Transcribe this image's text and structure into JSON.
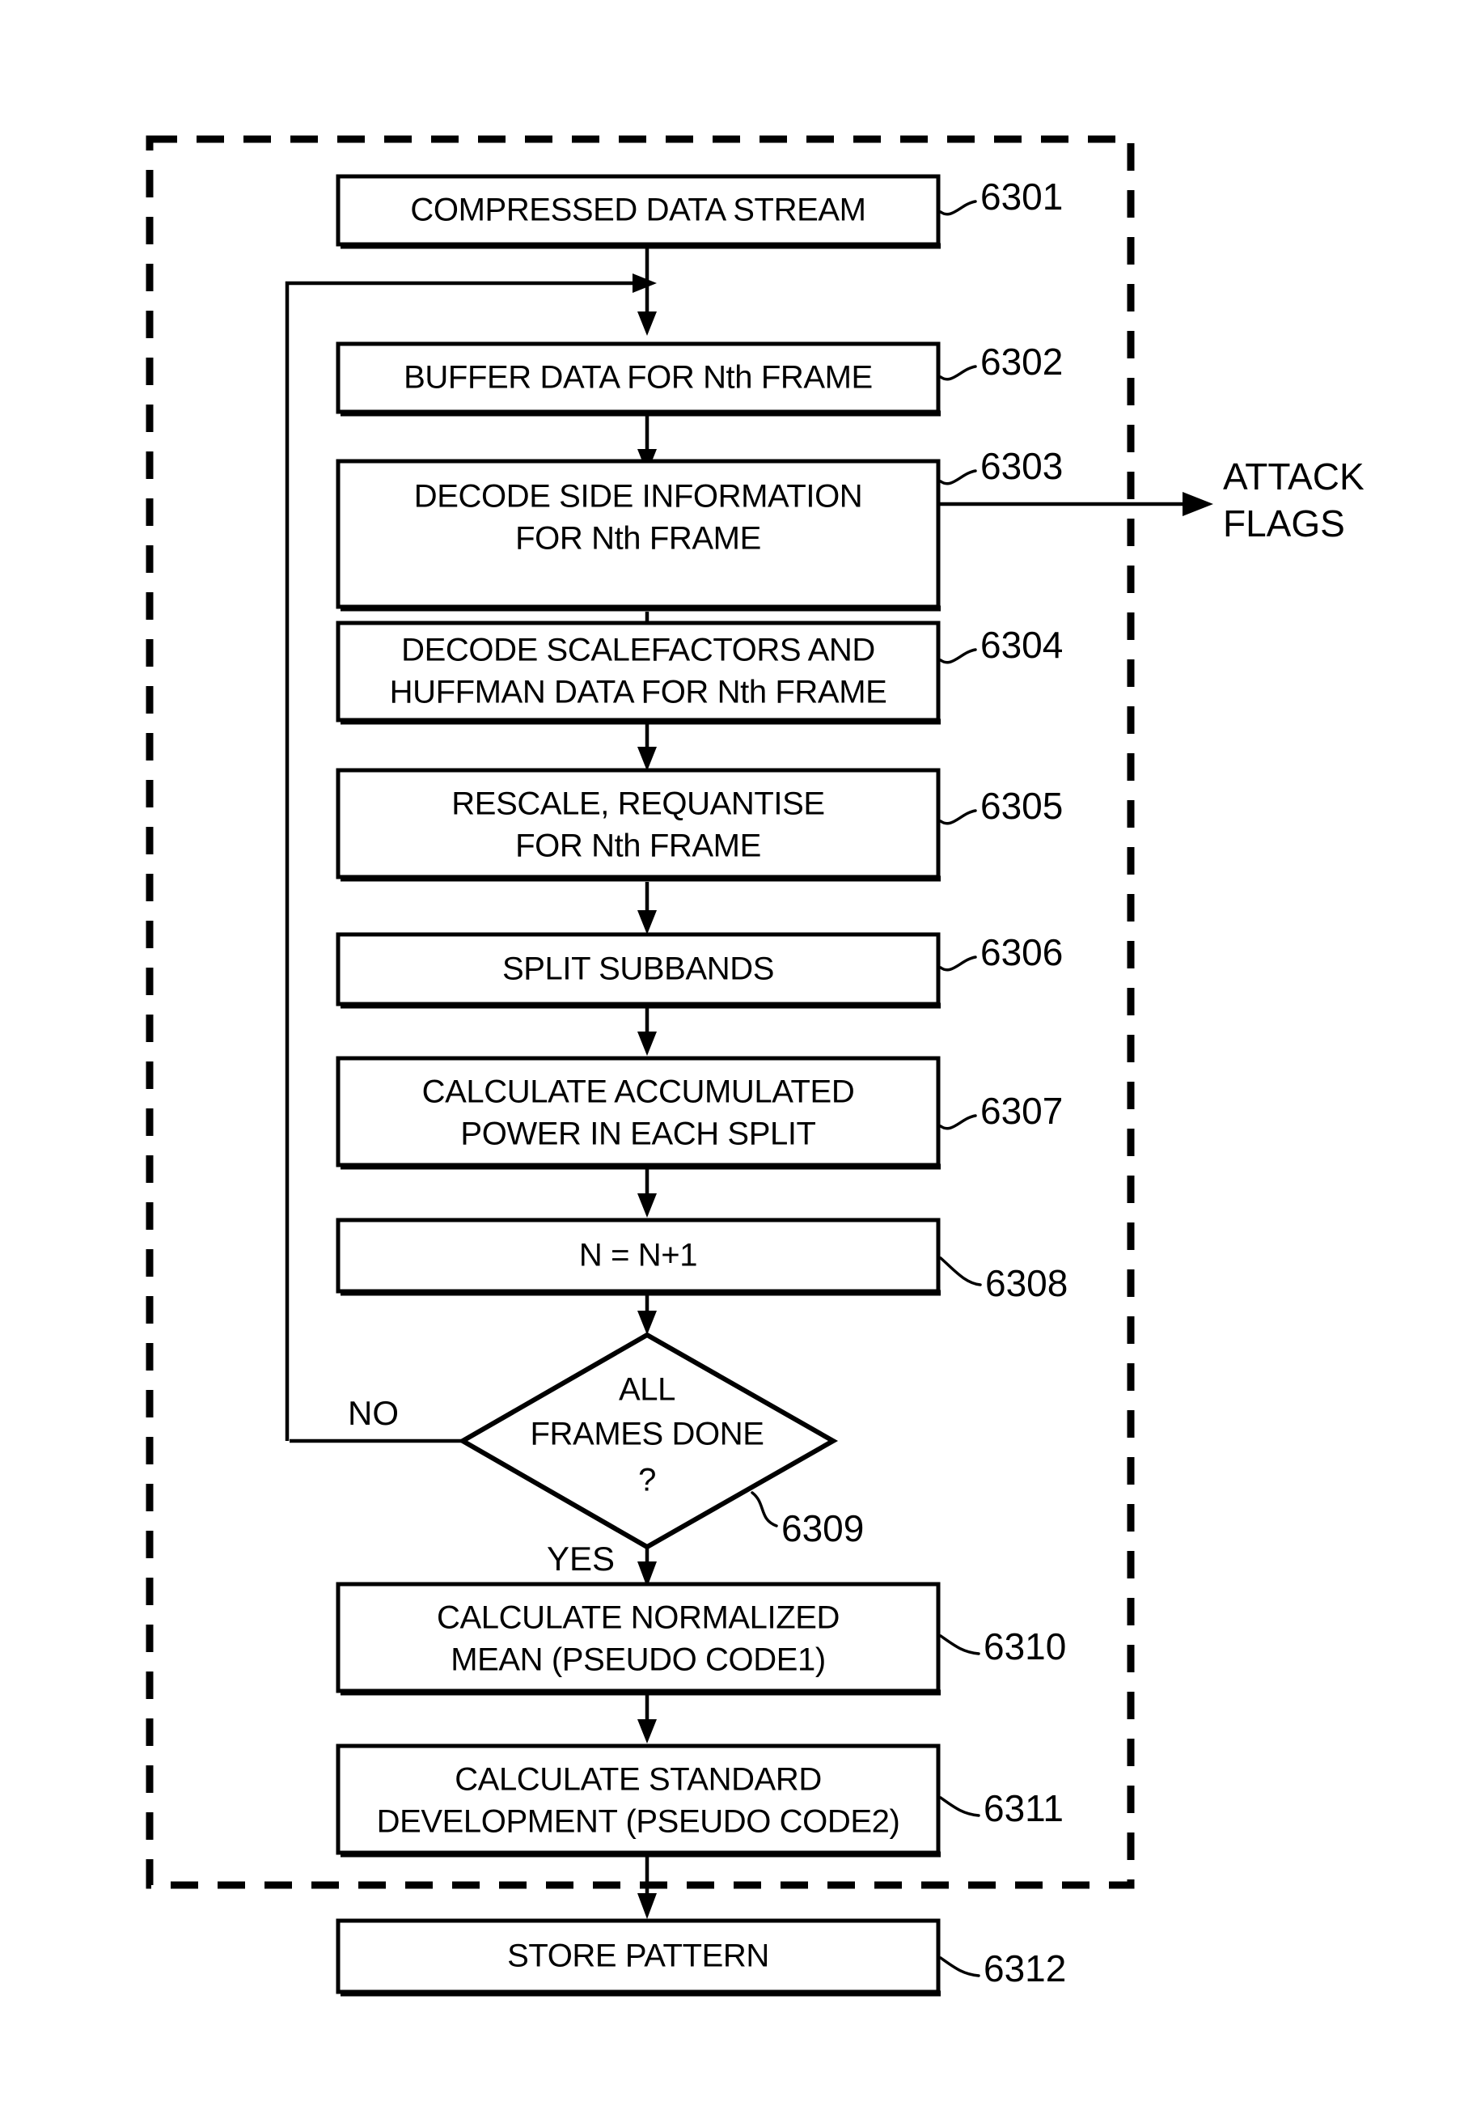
{
  "figure": {
    "title": "Flowchart 6300 - compressed audio stream attack pattern analysis",
    "dashed_group_label": "",
    "colors": {
      "ink": "#000000",
      "paper": "#ffffff"
    }
  },
  "nodes": [
    {
      "id": "6301",
      "type": "process",
      "ref": "6301",
      "lines": [
        "COMPRESSED DATA STREAM"
      ],
      "inside_dashed": true
    },
    {
      "id": "6302",
      "type": "process",
      "ref": "6302",
      "lines": [
        "BUFFER DATA FOR Nth FRAME"
      ],
      "inside_dashed": true
    },
    {
      "id": "6303",
      "type": "process",
      "ref": "6303",
      "lines": [
        "DECODE SIDE INFORMATION",
        "FOR Nth FRAME"
      ],
      "inside_dashed": true
    },
    {
      "id": "6304",
      "type": "process",
      "ref": "6304",
      "lines": [
        "DECODE SCALEFACTORS AND",
        "HUFFMAN DATA FOR Nth FRAME"
      ],
      "inside_dashed": true
    },
    {
      "id": "6305",
      "type": "process",
      "ref": "6305",
      "lines": [
        "RESCALE, REQUANTISE",
        "FOR Nth FRAME"
      ],
      "inside_dashed": true
    },
    {
      "id": "6306",
      "type": "process",
      "ref": "6306",
      "lines": [
        "SPLIT SUBBANDS"
      ],
      "inside_dashed": true
    },
    {
      "id": "6307",
      "type": "process",
      "ref": "6307",
      "lines": [
        "CALCULATE ACCUMULATED",
        "POWER IN EACH SPLIT"
      ],
      "inside_dashed": true
    },
    {
      "id": "6308",
      "type": "process",
      "ref": "6308",
      "lines": [
        "N = N+1"
      ],
      "inside_dashed": true
    },
    {
      "id": "6309",
      "type": "decision",
      "ref": "6309",
      "lines": [
        "ALL",
        "FRAMES DONE",
        "?"
      ],
      "inside_dashed": true
    },
    {
      "id": "6310",
      "type": "process",
      "ref": "6310",
      "lines": [
        "CALCULATE NORMALIZED",
        "MEAN (PSEUDO CODE1)"
      ],
      "inside_dashed": true
    },
    {
      "id": "6311",
      "type": "process",
      "ref": "6311",
      "lines": [
        "CALCULATE STANDARD",
        "DEVELOPMENT (PSEUDO CODE2)"
      ],
      "inside_dashed": true
    },
    {
      "id": "6312",
      "type": "process",
      "ref": "6312",
      "lines": [
        "STORE PATTERN"
      ],
      "inside_dashed": false
    }
  ],
  "edge_labels": {
    "decision_no": "NO",
    "decision_yes": "YES"
  },
  "external_outputs": [
    {
      "id": "attack-flags",
      "lines": [
        "ATTACK",
        "FLAGS"
      ],
      "from": "6303"
    }
  ]
}
